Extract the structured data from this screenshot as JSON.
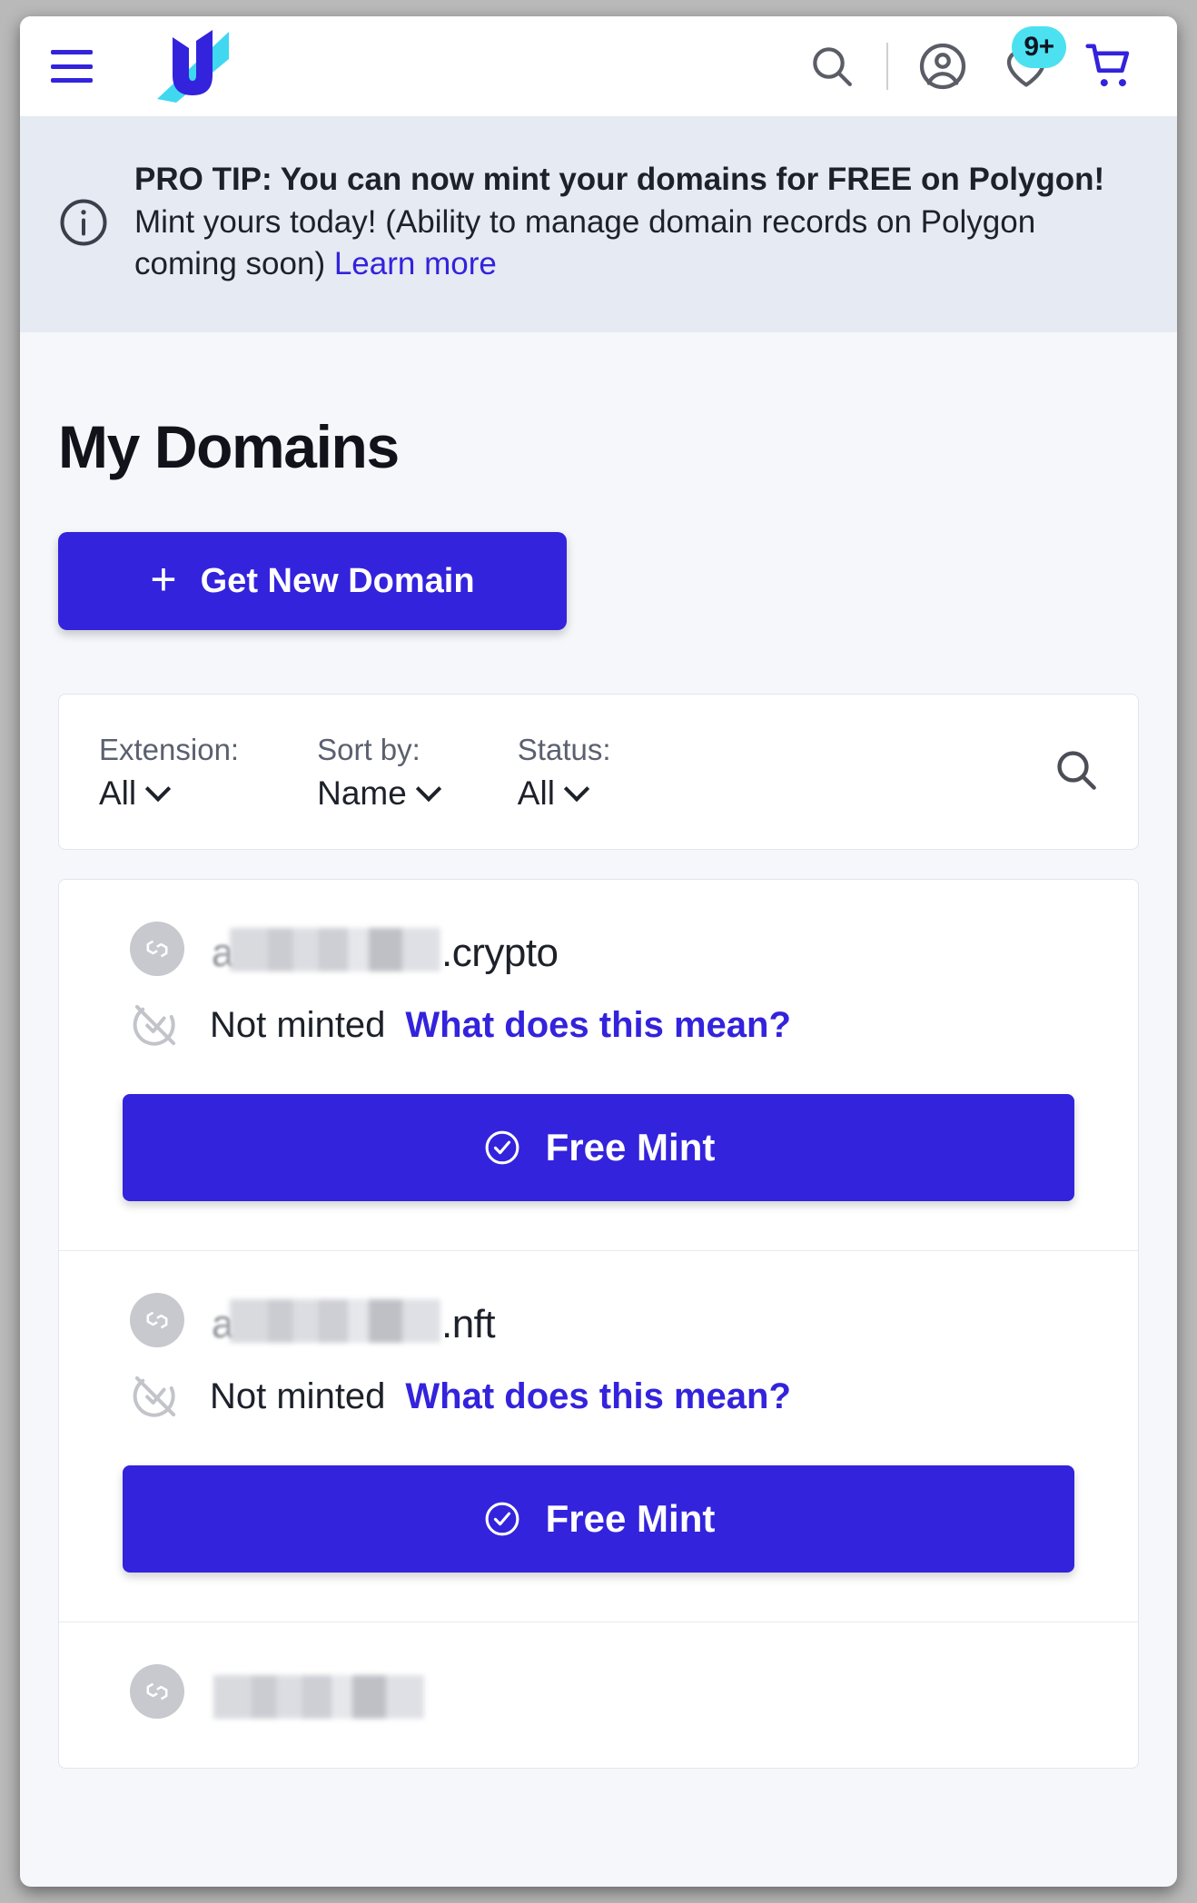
{
  "header": {
    "menu_icon": "hamburger-menu-icon",
    "logo_alt": "Unstoppable Domains",
    "search_icon": "search-icon",
    "account_icon": "account-circle-icon",
    "favorites_icon": "heart-icon",
    "favorites_badge": "9+",
    "cart_icon": "shopping-cart-icon",
    "badge_color": "#4ce1f0",
    "brand_color": "#3323dc"
  },
  "banner": {
    "info_icon": "info-circle-icon",
    "title": "PRO TIP: You can now mint your domains for FREE on Polygon!",
    "body": "Mint yours today! (Ability to manage domain records on Polygon coming soon) ",
    "link_label": "Learn more",
    "background": "#e6eaf2"
  },
  "main": {
    "page_title": "My Domains",
    "get_new_domain_label": "Get New Domain",
    "plus_icon": "plus-icon"
  },
  "filters": {
    "extension": {
      "label": "Extension:",
      "value": "All"
    },
    "sort_by": {
      "label": "Sort by:",
      "value": "Name"
    },
    "status": {
      "label": "Status:",
      "value": "All"
    },
    "search_icon": "search-icon"
  },
  "domains": [
    {
      "chain_icon": "polygon-icon",
      "name_redacted": true,
      "name_prefix": "a",
      "extension": ".crypto",
      "status_icon": "not-minted-icon",
      "status": "Not minted",
      "status_link": "What does this mean?",
      "action_icon": "check-circle-icon",
      "action_label": "Free Mint"
    },
    {
      "chain_icon": "polygon-icon",
      "name_redacted": true,
      "name_prefix": "a",
      "extension": ".nft",
      "status_icon": "not-minted-icon",
      "status": "Not minted",
      "status_link": "What does this mean?",
      "action_icon": "check-circle-icon",
      "action_label": "Free Mint"
    },
    {
      "chain_icon": "polygon-icon",
      "name_redacted": true,
      "name_prefix": "",
      "extension": "",
      "status_icon": "",
      "status": "",
      "status_link": "",
      "action_icon": "",
      "action_label": ""
    }
  ]
}
